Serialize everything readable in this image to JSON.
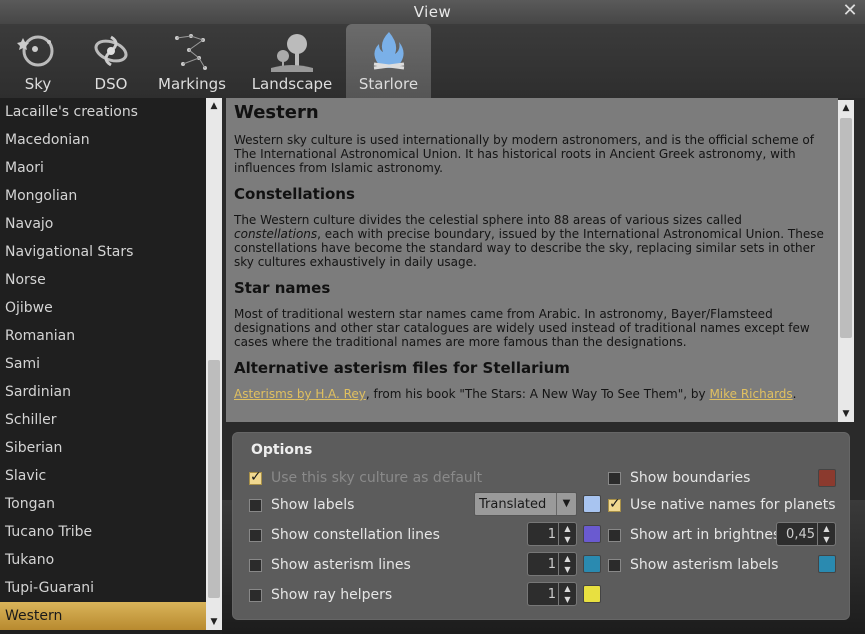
{
  "window": {
    "title": "View"
  },
  "tabs": [
    {
      "label": "Sky",
      "icon": "sky-icon"
    },
    {
      "label": "DSO",
      "icon": "dso-icon"
    },
    {
      "label": "Markings",
      "icon": "markings-icon"
    },
    {
      "label": "Landscape",
      "icon": "landscape-icon"
    },
    {
      "label": "Starlore",
      "icon": "starlore-icon"
    }
  ],
  "sidebar": {
    "items": [
      "Lacaille's creations",
      "Macedonian",
      "Maori",
      "Mongolian",
      "Navajo",
      "Navigational Stars",
      "Norse",
      "Ojibwe",
      "Romanian",
      "Sami",
      "Sardinian",
      "Schiller",
      "Siberian",
      "Slavic",
      "Tongan",
      "Tucano Tribe",
      "Tukano",
      "Tupi-Guarani",
      "Western"
    ],
    "selected": "Western"
  },
  "description": {
    "title": "Western",
    "intro": "Western sky culture is used internationally by modern astronomers, and is the official scheme of The International Astronomical Union. It has historical roots in Ancient Greek astronomy, with influences from Islamic astronomy.",
    "constellations_heading": "Constellations",
    "constellations_pre": "The Western culture divides the celestial sphere into 88 areas of various sizes called ",
    "constellations_em": "constellations",
    "constellations_post": ", each with precise boundary, issued by the International Astronomical Union. These constellations have become the standard way to describe the sky, replacing similar sets in other sky cultures exhaustively in daily usage.",
    "starnames_heading": "Star names",
    "starnames_text": "Most of traditional western star names came from Arabic. In astronomy, Bayer/Flamsteed designations and other star catalogues are widely used instead of traditional names except few cases where the traditional names are more famous than the designations.",
    "asterism_heading": "Alternative asterism files for Stellarium",
    "asterism_link1": "Asterisms by H.A. Rey",
    "asterism_mid": ", from his book \"The Stars: A New Way To See Them\", by ",
    "asterism_link2": "Mike Richards",
    "asterism_end": "."
  },
  "options": {
    "title": "Options",
    "use_default": {
      "label": "Use this sky culture as default",
      "checked": true
    },
    "show_boundaries": {
      "label": "Show boundaries",
      "color": "#8b3a2e"
    },
    "show_labels": {
      "label": "Show labels",
      "combo": "Translated",
      "color": "#a8c4f0"
    },
    "native_names": {
      "label": "Use native names for planets",
      "checked": true
    },
    "constellation_lines": {
      "label": "Show constellation lines",
      "value": "1",
      "color": "#6a5ad0"
    },
    "art_brightness": {
      "label": "Show art in brightness",
      "value": "0,45"
    },
    "asterism_lines": {
      "label": "Show asterism lines",
      "value": "1",
      "color": "#2a8ab0"
    },
    "asterism_labels": {
      "label": "Show asterism labels",
      "color": "#2a8ab0"
    },
    "ray_helpers": {
      "label": "Show ray helpers",
      "value": "1",
      "color": "#e8e040"
    }
  }
}
